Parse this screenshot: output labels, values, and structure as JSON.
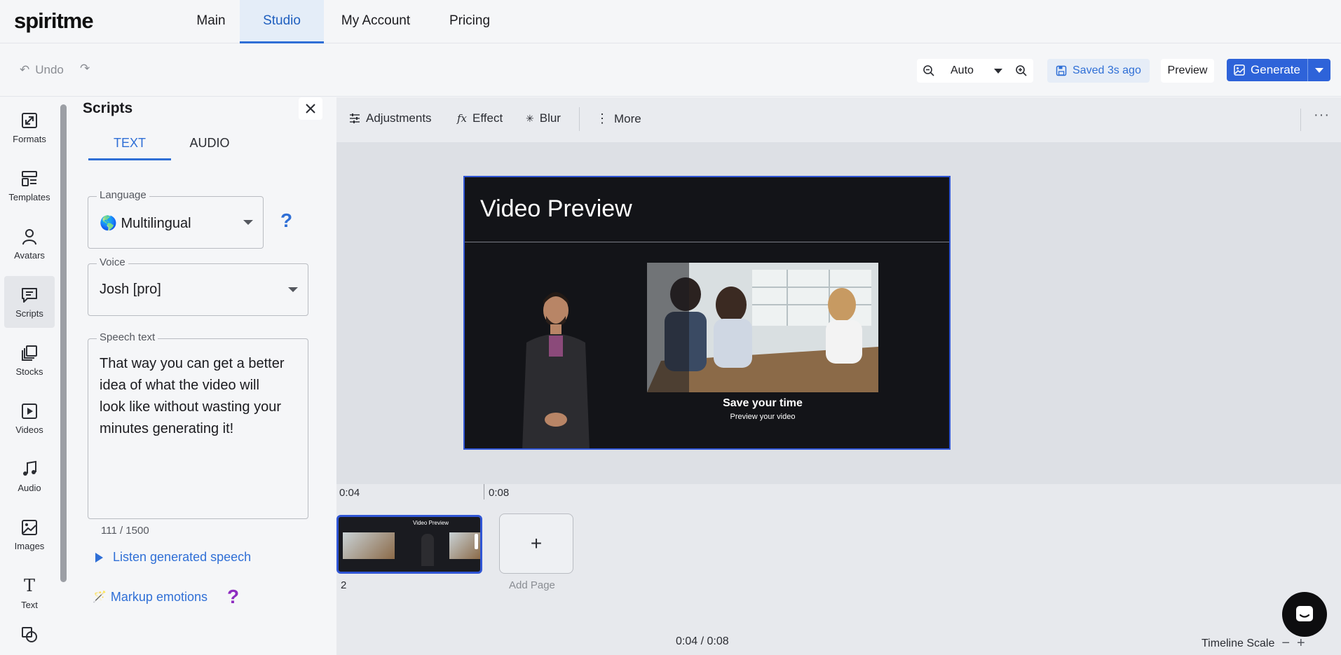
{
  "app": {
    "logo": "spiritme"
  },
  "nav": {
    "tabs": [
      "Main",
      "Studio",
      "My Account",
      "Pricing"
    ],
    "active": "Studio"
  },
  "toolbar": {
    "undo_label": "Undo",
    "zoom_value": "Auto",
    "saved_label": "Saved 3s ago",
    "preview_label": "Preview",
    "generate_label": "Generate"
  },
  "rail": {
    "items": [
      "Formats",
      "Templates",
      "Avatars",
      "Scripts",
      "Stocks",
      "Videos",
      "Audio",
      "Images",
      "Text"
    ],
    "active": "Scripts"
  },
  "panel": {
    "title": "Scripts",
    "tabs": [
      "TEXT",
      "AUDIO"
    ],
    "active_tab": "TEXT",
    "language_label": "Language",
    "language_value": "🌎 Multilingual",
    "voice_label": "Voice",
    "voice_value": "Josh [pro]",
    "speech_label": "Speech text",
    "speech_text": "That way you can get a better idea of what the video will look like without wasting your minutes generating it!",
    "counter": "111 / 1500",
    "listen_label": "Listen generated speech",
    "markup_label": "Markup emotions",
    "help": "?"
  },
  "canvas_tools": {
    "adjustments": "Adjustments",
    "effect": "Effect",
    "blur": "Blur",
    "more": "More"
  },
  "slide": {
    "title": "Video Preview",
    "caption_title": "Save your time",
    "caption_sub": "Preview your video"
  },
  "timeline": {
    "ticks": [
      "0:04",
      "0:08"
    ],
    "thumb_title": "Video Preview",
    "page_number": "2",
    "add_page_label": "Add Page",
    "add_symbol": "+",
    "timecode": "0:04 / 0:08",
    "scale_label": "Timeline Scale"
  },
  "colors": {
    "accent": "#2f6fd6",
    "generate": "#2e63d9",
    "slide_border": "#2f55d4"
  }
}
